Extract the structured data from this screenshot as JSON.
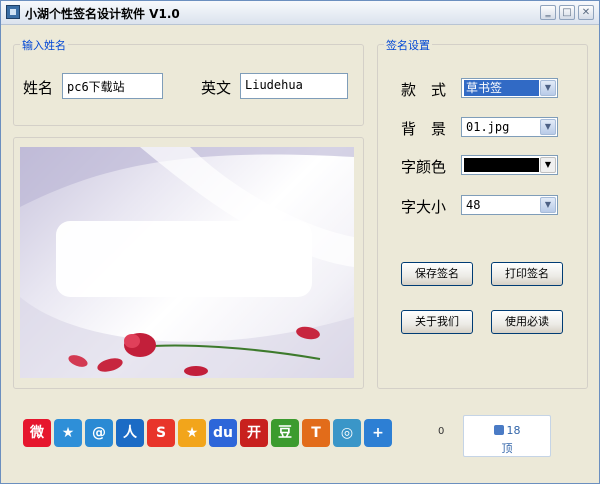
{
  "window": {
    "title": "小湖个性签名设计软件 V1.0"
  },
  "name_group": {
    "label": "输入姓名",
    "name_label": "姓名",
    "name_value": "pc6下载站",
    "english_label": "英文",
    "english_value": "Liudehua"
  },
  "sig_group": {
    "label": "签名设置",
    "style_label": "款　式",
    "style_value": "草书签",
    "bg_label": "背　景",
    "bg_value": "01.jpg",
    "color_label": "字颜色",
    "color_value": "#000000",
    "size_label": "字大小",
    "size_value": "48"
  },
  "buttons": {
    "save": "保存签名",
    "print": "打印签名",
    "about": "关于我们",
    "readme": "使用必读"
  },
  "share": {
    "icons": [
      {
        "name": "weibo-icon",
        "glyph": "微",
        "color": "#e6162d"
      },
      {
        "name": "qzone-icon",
        "glyph": "★",
        "color": "#2e8fd8"
      },
      {
        "name": "tencent-weibo-icon",
        "glyph": "@",
        "color": "#2a8ad4"
      },
      {
        "name": "renren-icon",
        "glyph": "人",
        "color": "#1b6bc5"
      },
      {
        "name": "sohu-icon",
        "glyph": "S",
        "color": "#e8352a"
      },
      {
        "name": "pengyou-icon",
        "glyph": "★",
        "color": "#f2a51b"
      },
      {
        "name": "baidu-icon",
        "glyph": "du",
        "color": "#2d66d9"
      },
      {
        "name": "kaixin-icon",
        "glyph": "开",
        "color": "#c8211e"
      },
      {
        "name": "douban-icon",
        "glyph": "豆",
        "color": "#3c9b2e"
      },
      {
        "name": "tianya-icon",
        "glyph": "T",
        "color": "#e26c1a"
      },
      {
        "name": "qq-space-icon",
        "glyph": "◎",
        "color": "#3a96c8"
      },
      {
        "name": "more-share-icon",
        "glyph": "+",
        "color": "#2d7fd4"
      }
    ],
    "count": "0",
    "like_count": "18",
    "like_unit": "顶"
  }
}
